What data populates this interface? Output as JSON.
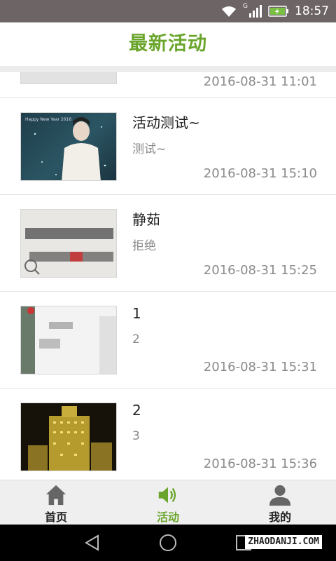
{
  "status_bar": {
    "time": "18:57",
    "network_label": "G"
  },
  "header": {
    "title": "最新活动"
  },
  "list": {
    "items": [
      {
        "title": "",
        "desc": "",
        "time": "2016-08-31 11:01"
      },
      {
        "title": "活动测试~",
        "desc": "测试~",
        "time": "2016-08-31 15:10",
        "thumb_text": "Happy New Year 2016"
      },
      {
        "title": "静茹",
        "desc": "拒绝",
        "time": "2016-08-31 15:25"
      },
      {
        "title": "1",
        "desc": "2",
        "time": "2016-08-31 15:31"
      },
      {
        "title": "2",
        "desc": "3",
        "time": "2016-08-31 15:36"
      }
    ]
  },
  "bottom_nav": [
    {
      "label": "首页",
      "icon": "home-icon"
    },
    {
      "label": "活动",
      "icon": "speaker-icon",
      "active": true
    },
    {
      "label": "我的",
      "icon": "user-icon"
    }
  ],
  "watermark": "ZHAODANJI.COM",
  "colors": {
    "accent": "#6aa52b",
    "status_bar": "#6d6466",
    "muted_text": "#8a8a8a"
  }
}
